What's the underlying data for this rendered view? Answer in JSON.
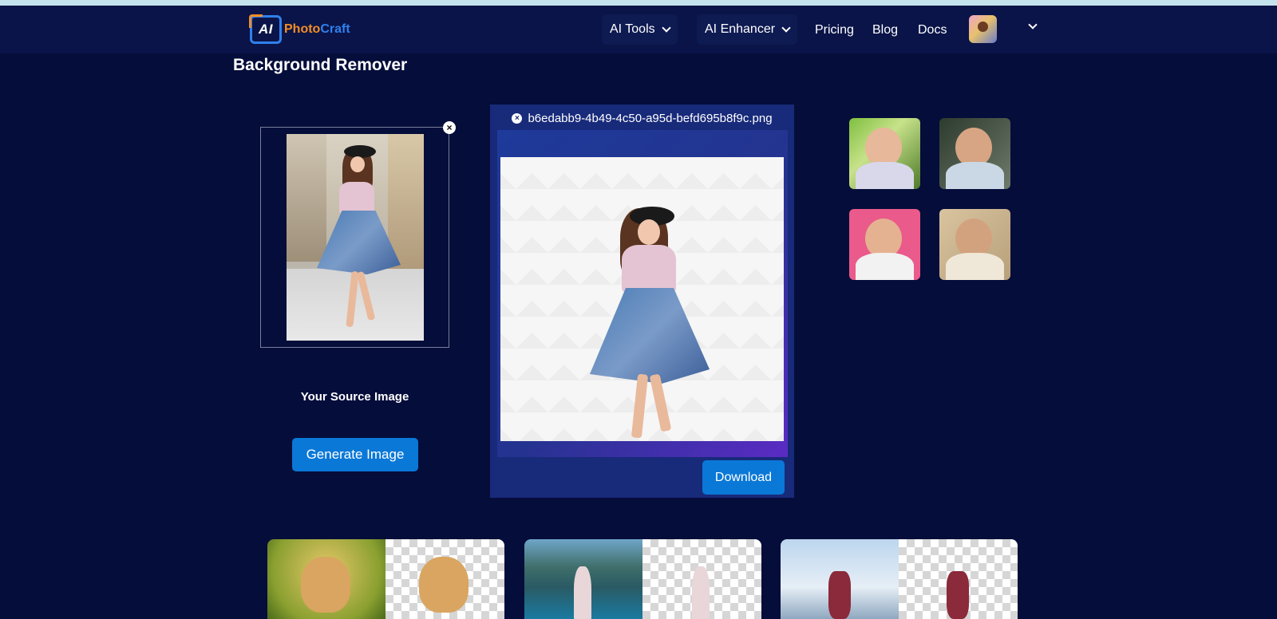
{
  "brand": {
    "ai": "AI",
    "name_part1": "Photo",
    "name_part2": "Craft"
  },
  "nav": {
    "ai_tools": "AI Tools",
    "ai_enhancer": "AI Enhancer",
    "pricing": "Pricing",
    "blog": "Blog",
    "docs": "Docs"
  },
  "page": {
    "title": "Background Remover"
  },
  "source": {
    "label": "Your Source Image",
    "generate_label": "Generate Image"
  },
  "result": {
    "filename": "b6edabb9-4b49-4c50-a95d-befd695b8f9c.png",
    "download_label": "Download"
  },
  "colors": {
    "page_bg": "#050d3a",
    "navbar_bg": "#0a1448",
    "button_blue": "#0a78d7",
    "result_panel": "#182a7a",
    "logo_orange": "#f28c28",
    "logo_blue": "#2f80ed"
  },
  "icons": {
    "close": "close-icon",
    "chevron": "chevron-down-icon"
  }
}
